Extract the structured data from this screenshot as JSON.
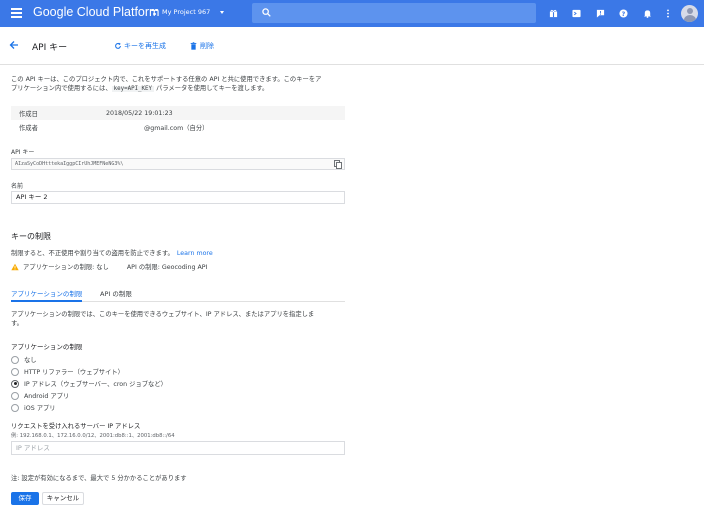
{
  "topbar": {
    "brand": "Google Cloud Platform",
    "project": "My Project 967",
    "icons": [
      "gift-icon",
      "terminal-icon",
      "alert-icon",
      "help-icon",
      "bell-icon",
      "more-vert-icon",
      "avatar"
    ]
  },
  "header": {
    "title": "API キー",
    "regenerate_label": "キーを再生成",
    "delete_label": "削除"
  },
  "description": {
    "line1": "この API キーは、このプロジェクト内で、これをサポートする任意の API と共に使用できます。このキーをア",
    "line2_before": "プリケーション内で使用するには、",
    "line2_code": "key=API_KEY",
    "line2_after": " パラメータを使用してキーを渡します。"
  },
  "info": {
    "created_label": "作成日",
    "created_value": "2018/05/22 19:01:23",
    "creator_label": "作成者",
    "creator_value": "@gmail.com（自分）"
  },
  "api_key": {
    "label": "API キー",
    "value": "AIzaSyCoDHtttekaIggpCIrUhJMEFNeNG3%\\"
  },
  "name_field": {
    "label": "名前",
    "value": "API キー 2"
  },
  "restrictions": {
    "title": "キーの制限",
    "desc": "制限すると、不正使用や割り当ての盗用を防止できます。",
    "learn_more": "Learn more",
    "app_restriction_status": "アプリケーションの制限: なし",
    "api_restriction_status": "API の制限: Geocoding API"
  },
  "tabs": {
    "app": "アプリケーションの制限",
    "api": "API の制限"
  },
  "app_restriction": {
    "desc": "アプリケーションの制限では、このキーを使用できるウェブサイト、IP アドレス、またはアプリを指定しま",
    "desc2": "す。",
    "radios_title": "アプリケーションの制限",
    "options": [
      "なし",
      "HTTP リファラー（ウェブサイト）",
      "IP アドレス（ウェブサーバー、cron ジョブなど）",
      "Android アプリ",
      "iOS アプリ"
    ],
    "selected_index": 2
  },
  "ip_section": {
    "title": "リクエストを受け入れるサーバー IP アドレス",
    "example": "例: 192.168.0.1、172.16.0.0/12、2001:db8::1、2001:db8::/64",
    "placeholder": "IP アドレス"
  },
  "footer": {
    "note": "注: 設定が有効になるまで、最大で 5 分かかることがあります",
    "save": "保存",
    "cancel": "キャンセル"
  }
}
